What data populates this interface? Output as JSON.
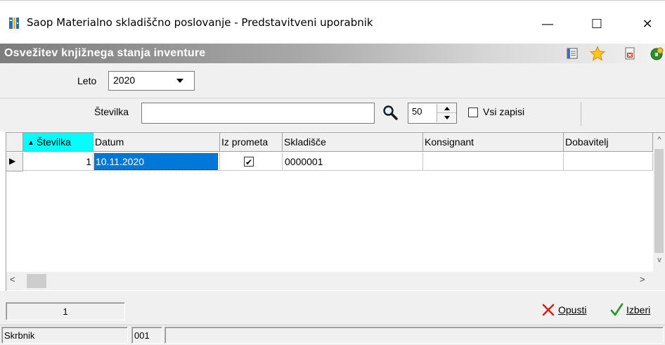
{
  "window": {
    "title": "Saop Materialno skladiščno poslovanje - Predstavitveni uporabnik",
    "minimize_glyph": "—",
    "maximize_glyph": "☐",
    "close_glyph": "✕"
  },
  "header": {
    "title": "Osvežitev knjižnega stanja inventure",
    "icons": [
      "list-icon",
      "star-icon",
      "delete-document-icon",
      "exit-icon"
    ]
  },
  "form": {
    "leto_label": "Leto",
    "leto_value": "2020",
    "stevilka_label": "Številka",
    "stevilka_value": "",
    "limit_value": "50",
    "vsi_zapisi_label": "Vsi zapisi",
    "vsi_zapisi_checked": false
  },
  "grid": {
    "columns": [
      {
        "label": "Številka",
        "sorted": "ascending",
        "sort_glyph": "▲"
      },
      {
        "label": "Datum"
      },
      {
        "label": "Iz prometa"
      },
      {
        "label": "Skladišče"
      },
      {
        "label": "Konsignant"
      },
      {
        "label": "Dobavitelj"
      }
    ],
    "rows": [
      {
        "stevilka": "1",
        "datum": "10.11.2020",
        "iz_prometa": true,
        "skladisce": "0000001",
        "konsignant": "",
        "dobavitelj": ""
      }
    ],
    "row_indicator_glyph": "▶",
    "check_glyph": "✔"
  },
  "scrollbar": {
    "left_glyph": "<",
    "right_glyph": ">",
    "up_glyph": "^",
    "down_glyph": "v"
  },
  "footer": {
    "record_count": "1",
    "opusti_label": "Opusti",
    "izberi_label": "Izberi"
  },
  "status": {
    "label": "Skrbnik",
    "code": "001",
    "extra": ""
  },
  "colors": {
    "active_sort_column": "#00ffff",
    "selection": "#0078d7",
    "header_gradient_start": "#7d7d7d"
  }
}
